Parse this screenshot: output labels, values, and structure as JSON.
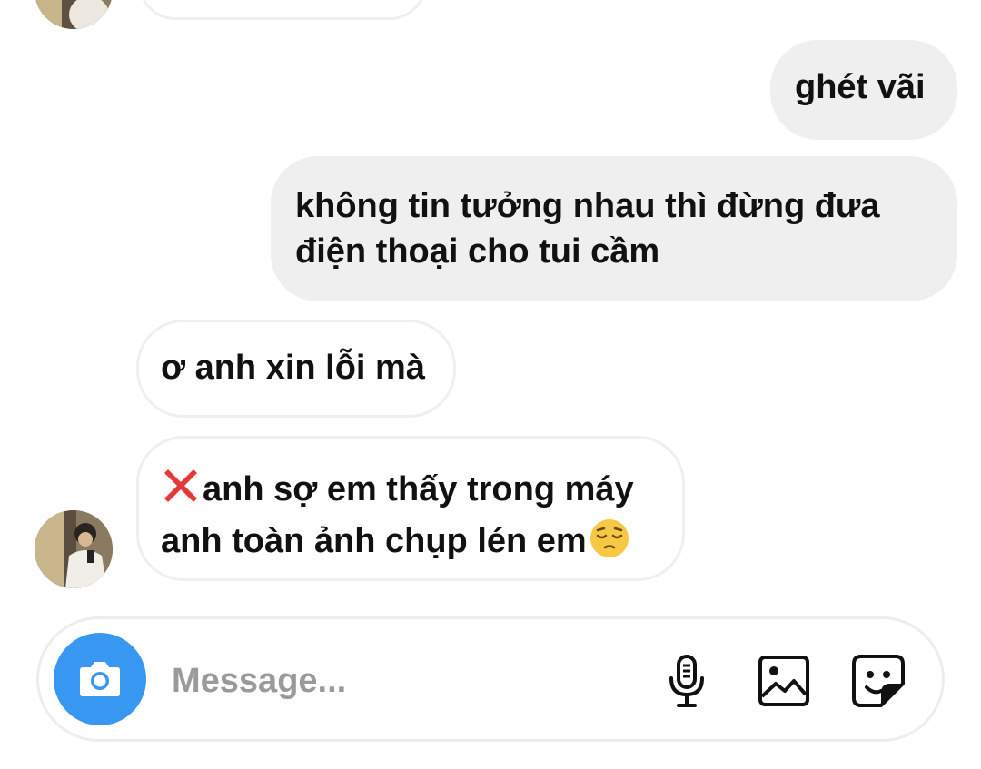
{
  "messages": [
    {
      "direction": "outgoing",
      "text": "ghét vãi"
    },
    {
      "direction": "outgoing",
      "lines": [
        "không tin tưởng nhau thì đừng đưa",
        "điện thoại cho tui cầm"
      ]
    },
    {
      "direction": "incoming",
      "text": "ơ anh xin lỗi mà"
    },
    {
      "direction": "incoming",
      "lines": [
        "anh sợ em thấy trong máy",
        "anh toàn ảnh chụp lén em"
      ],
      "leading_emoji": "red-x-emoji",
      "trailing_emoji": "pensive-face-emoji"
    }
  ],
  "composer": {
    "placeholder": "Message...",
    "camera_icon": "camera-icon",
    "mic_icon": "microphone-icon",
    "gallery_icon": "image-icon",
    "sticker_icon": "sticker-icon"
  },
  "colors": {
    "accent": "#3897f0",
    "outgoing_bubble": "#efefef",
    "incoming_border": "#efefef",
    "placeholder": "#9a9a9a"
  }
}
